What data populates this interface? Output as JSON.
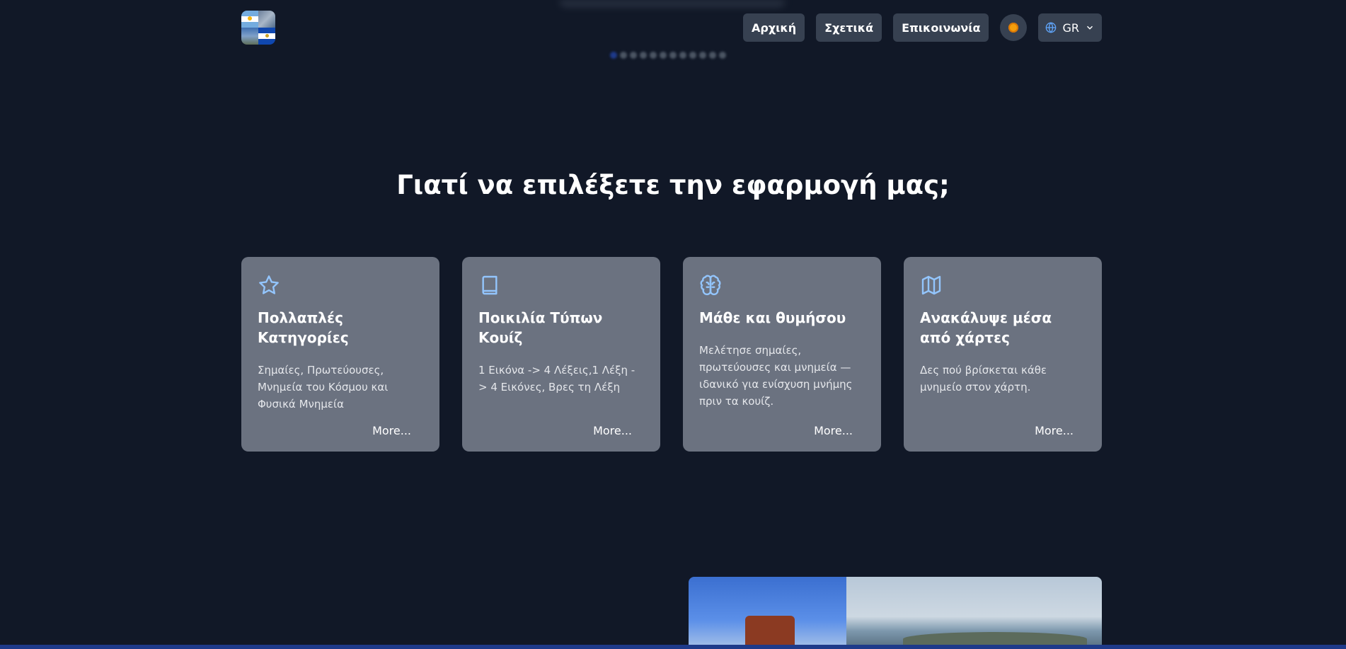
{
  "nav": {
    "home": "Αρχική",
    "about": "Σχετικά",
    "contact": "Επικοινωνία",
    "language": "GR"
  },
  "carousel": {
    "dot_count": 12,
    "active_index": 0
  },
  "section_title": "Γιατί να επιλέξετε την εφαρμογή μας;",
  "cards": [
    {
      "icon": "star-icon",
      "title": "Πολλαπλές Κατηγορίες",
      "description": "Σημαίες, Πρωτεύουσες, Μνημεία του Κόσμου και Φυσικά Μνημεία",
      "more": "More..."
    },
    {
      "icon": "book-icon",
      "title": "Ποικιλία Τύπων Κουίζ",
      "description": "1 Εικόνα -> 4 Λέξεις,1 Λέξη -> 4 Εικόνες, Βρες τη Λέξη",
      "more": "More..."
    },
    {
      "icon": "brain-icon",
      "title": "Μάθε και θυμήσου",
      "description": "Μελέτησε σημαίες, πρωτεύουσες και μνημεία — ιδανικό για ενίσχυση μνήμης πριν τα κουίζ.",
      "more": "More..."
    },
    {
      "icon": "map-icon",
      "title": "Ανακάλυψε μέσα από χάρτες",
      "description": "Δες πού βρίσκεται κάθε μνημείο στον χάρτη.",
      "more": "More..."
    }
  ],
  "colors": {
    "background": "#111827",
    "card": "#6b7280",
    "nav_button": "#374151",
    "icon_accent": "#93c5fd"
  }
}
